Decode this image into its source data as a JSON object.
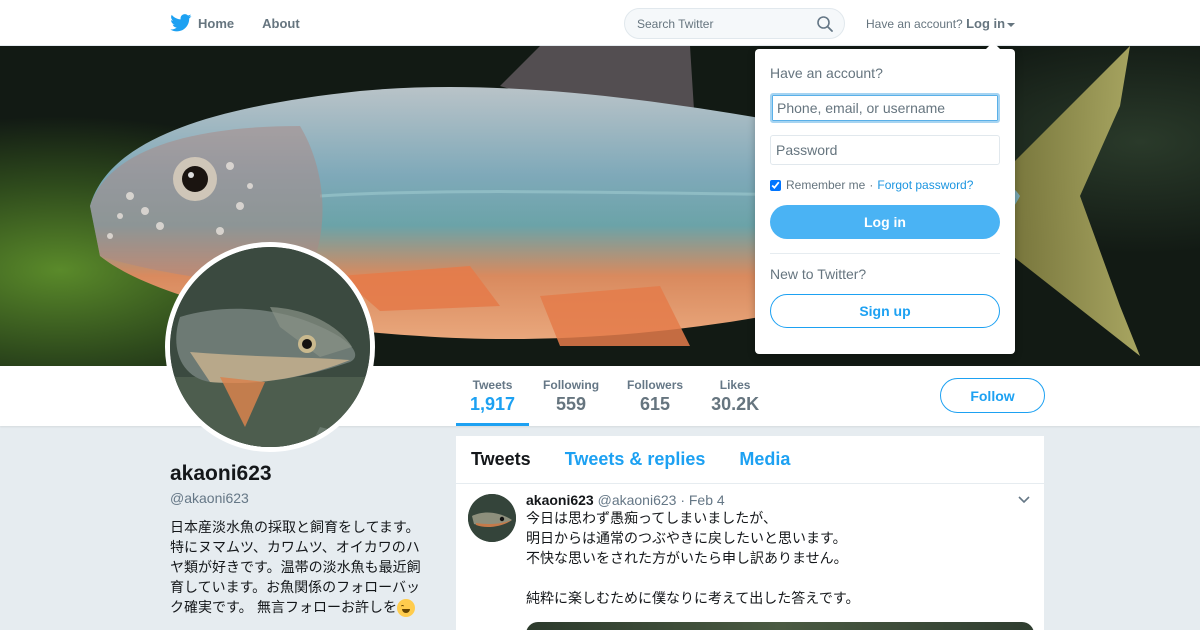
{
  "nav": {
    "home_label": "Home",
    "about_label": "About",
    "search_placeholder": "Search Twitter",
    "have_account_text": "Have an account?",
    "login_label": "Log in"
  },
  "profile": {
    "name": "akaoni623",
    "handle": "@akaoni623",
    "bio": "日本産淡水魚の採取と飼育をしてます。特にヌマムツ、カワムツ、オイカワのハヤ類が好きです。温帯の淡水魚も最近飼育しています。お魚関係のフォローバック確実です。 無言フォローお許しを",
    "bio_emoji": "grinning-sweat-emoji",
    "follow_label": "Follow"
  },
  "stats": [
    {
      "label": "Tweets",
      "value": "1,917",
      "active": true
    },
    {
      "label": "Following",
      "value": "559"
    },
    {
      "label": "Followers",
      "value": "615"
    },
    {
      "label": "Likes",
      "value": "30.2K"
    }
  ],
  "timeline": {
    "tabs": [
      "Tweets",
      "Tweets & replies",
      "Media"
    ],
    "active_tab": "Tweets",
    "tweet": {
      "name": "akaoni623",
      "handle": "@akaoni623",
      "date": "· Feb 4",
      "text": "今日は思わず愚痴ってしまいましたが、\n明日からは通常のつぶやきに戻したいと思います。\n不快な思いをされた方がいたら申し訳ありません。\n\n純粋に楽しむために僕なりに考えて出した答えです。"
    }
  },
  "login_dropdown": {
    "title": "Have an account?",
    "username_placeholder": "Phone, email, or username",
    "password_placeholder": "Password",
    "remember_label": "Remember me",
    "separator": "·",
    "forgot_label": "Forgot password?",
    "remember_checked": true,
    "login_button": "Log in",
    "new_text": "New to Twitter?",
    "signup_button": "Sign up"
  },
  "colors": {
    "accent": "#1da1f2",
    "login_button_bg": "#4ab3f4",
    "page_bg": "#e6ecf0"
  },
  "icons": [
    "twitter-bird-icon",
    "search-icon",
    "caret-down-icon",
    "chevron-down-icon"
  ]
}
